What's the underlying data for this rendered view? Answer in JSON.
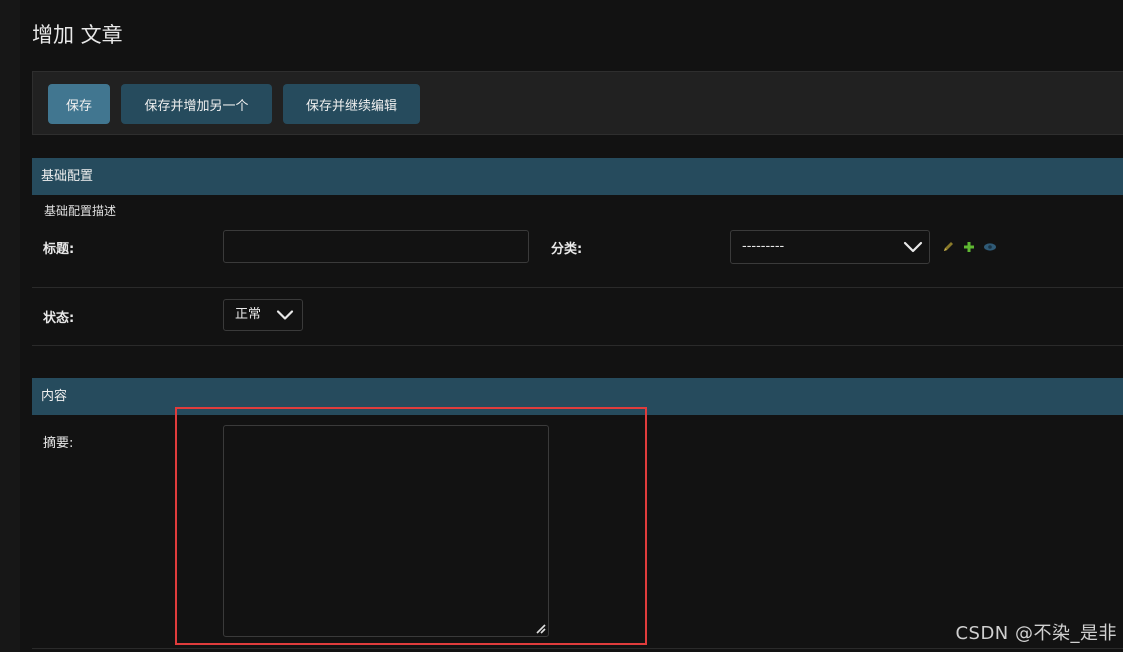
{
  "page": {
    "title": "增加 文章"
  },
  "submit_row": {
    "save_label": "保存",
    "save_add_label": "保存并增加另一个",
    "save_continue_label": "保存并继续编辑"
  },
  "fieldsets": [
    {
      "header": "基础配置",
      "description": "基础配置描述",
      "fields": {
        "title": {
          "label": "标题:",
          "value": ""
        },
        "category": {
          "label": "分类:",
          "selected": "---------"
        },
        "status": {
          "label": "状态:",
          "selected": "正常"
        }
      },
      "related_icons": [
        "pencil-icon",
        "plus-icon",
        "eye-icon"
      ]
    },
    {
      "header": "内容",
      "fields": {
        "summary": {
          "label": "摘要:",
          "value": ""
        }
      }
    }
  ],
  "watermark": "CSDN @不染_是非",
  "colors": {
    "background": "#121212",
    "header_bg": "#264b5d",
    "primary_button": "#417690",
    "secondary_button": "#264b5d",
    "highlight": "#e03c3c",
    "add_icon": "#5fb832",
    "edit_icon": "#8a7a2a",
    "view_icon": "#2f5a76"
  }
}
